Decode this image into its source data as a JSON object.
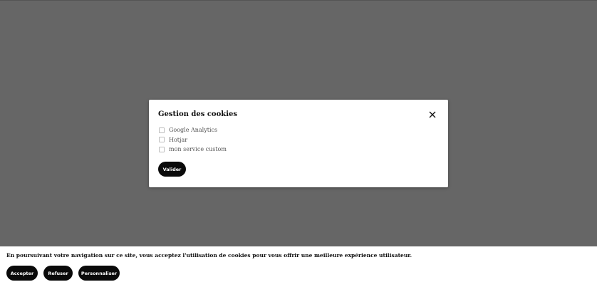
{
  "modal": {
    "title": "Gestion des cookies",
    "options": [
      {
        "label": "Google Analytics",
        "checked": false
      },
      {
        "label": "Hotjar",
        "checked": false
      },
      {
        "label": "mon service custom",
        "checked": false
      }
    ],
    "validate_label": "Valider",
    "close_icon": "close-icon"
  },
  "banner": {
    "text": "En poursuivant votre navigation sur ce site, vous acceptez l'utilisation de cookies pour vous offrir une meilleure expérience utilisateur.",
    "accept_label": "Accepter",
    "refuse_label": "Refuser",
    "customize_label": "Personnaliser"
  },
  "colors": {
    "overlay": "#666666",
    "button": "#0a0a0a",
    "button_text": "#ffffff"
  }
}
